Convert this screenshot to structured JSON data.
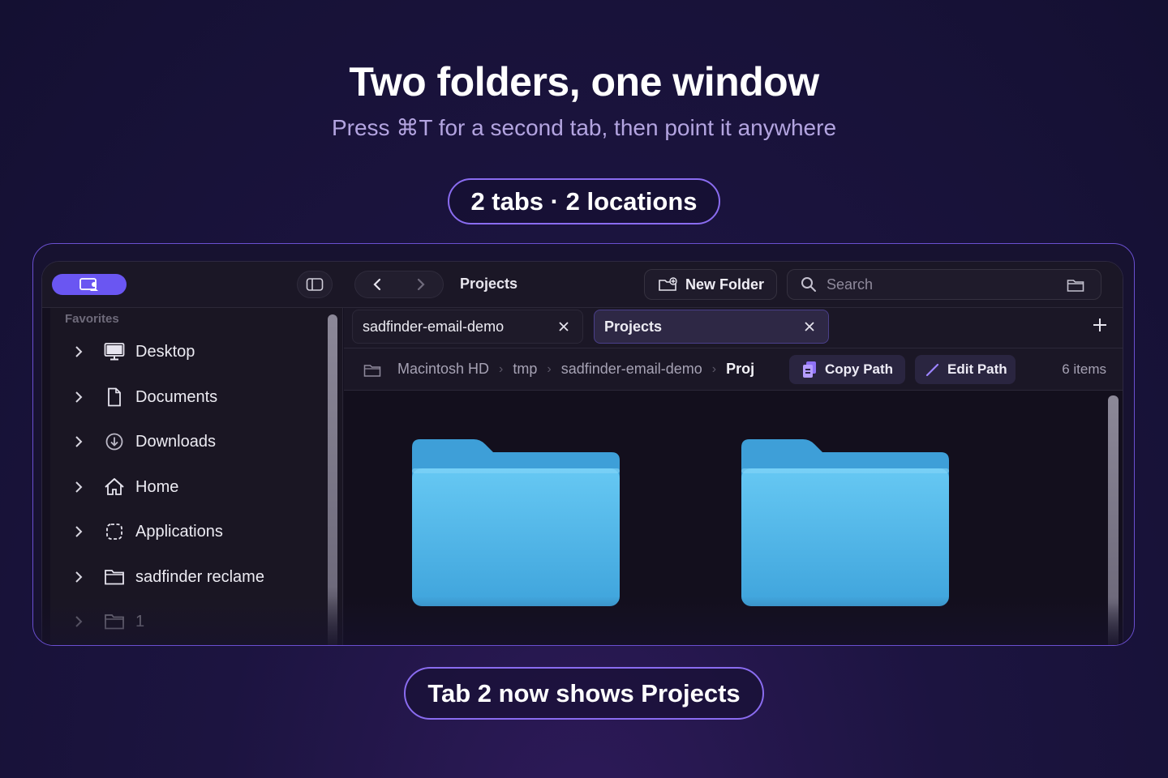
{
  "hero": {
    "title": "Two folders, one window",
    "subtitle": "Press ⌘T for a second tab, then point it anywhere",
    "badge_top": "2 tabs · 2 locations",
    "badge_bottom": "Tab 2 now shows Projects"
  },
  "toolbar": {
    "title": "Projects",
    "new_folder_label": "New Folder",
    "search_placeholder": "Search"
  },
  "sidebar": {
    "section_header": "Favorites",
    "items": [
      {
        "label": "Desktop",
        "icon": "desktop-icon"
      },
      {
        "label": "Documents",
        "icon": "document-icon"
      },
      {
        "label": "Downloads",
        "icon": "download-icon"
      },
      {
        "label": "Home",
        "icon": "home-icon"
      },
      {
        "label": "Applications",
        "icon": "applications-icon"
      },
      {
        "label": "sadfinder reclame",
        "icon": "folder-icon"
      },
      {
        "label": "1",
        "icon": "folder-icon"
      }
    ]
  },
  "tabs": [
    {
      "label": "sadfinder-email-demo",
      "active": false
    },
    {
      "label": "Projects",
      "active": true
    }
  ],
  "path": {
    "crumbs": [
      "Macintosh HD",
      "tmp",
      "sadfinder-email-demo"
    ],
    "current": "Proj",
    "copy_label": "Copy Path",
    "edit_label": "Edit Path",
    "item_count": "6 items"
  },
  "colors": {
    "accent": "#6a56f2",
    "folder_blue": "#4fb4e8",
    "background": "#141032"
  }
}
